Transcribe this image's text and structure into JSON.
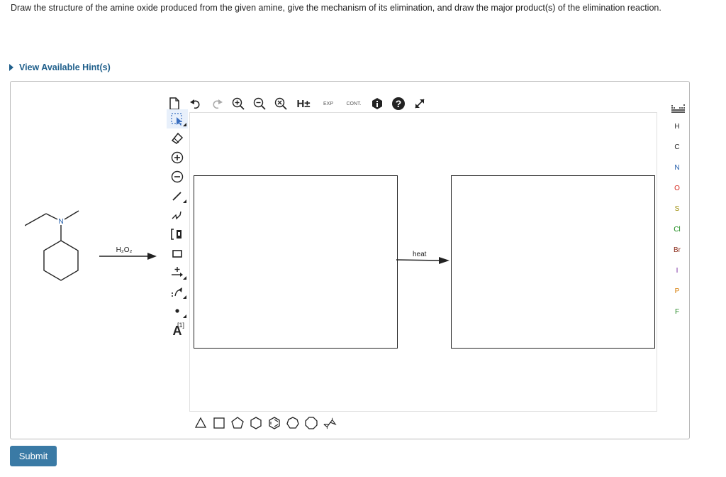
{
  "question": "Draw the structure of the amine oxide produced from the given amine, give the mechanism of its elimination, and draw the major product(s) of the elimination reaction.",
  "hint": {
    "label": "View Available Hint(s)"
  },
  "reagent": {
    "text": "H₂O₂"
  },
  "reactant": {
    "atom": "N"
  },
  "toolbar": {
    "h_label": "H±",
    "exp_label": "EXP",
    "cont_label": "CONT."
  },
  "left_tools": {
    "label_tool": "A",
    "label_index": "[1]"
  },
  "canvas": {
    "heat_label": "heat"
  },
  "atoms": [
    "H",
    "C",
    "N",
    "O",
    "S",
    "Cl",
    "Br",
    "I",
    "P",
    "F"
  ],
  "atom_colors": {
    "H": "#222222",
    "C": "#222222",
    "N": "#1e5aa8",
    "O": "#d62a1e",
    "S": "#9a8a00",
    "Cl": "#1a8a1a",
    "Br": "#8b2c1a",
    "I": "#7a2aa0",
    "P": "#d67a00",
    "F": "#2a8a2a"
  },
  "submit": {
    "label": "Submit"
  },
  "colors": {
    "accent": "#1f5f8b",
    "submit_bg": "#3a7aa5"
  }
}
